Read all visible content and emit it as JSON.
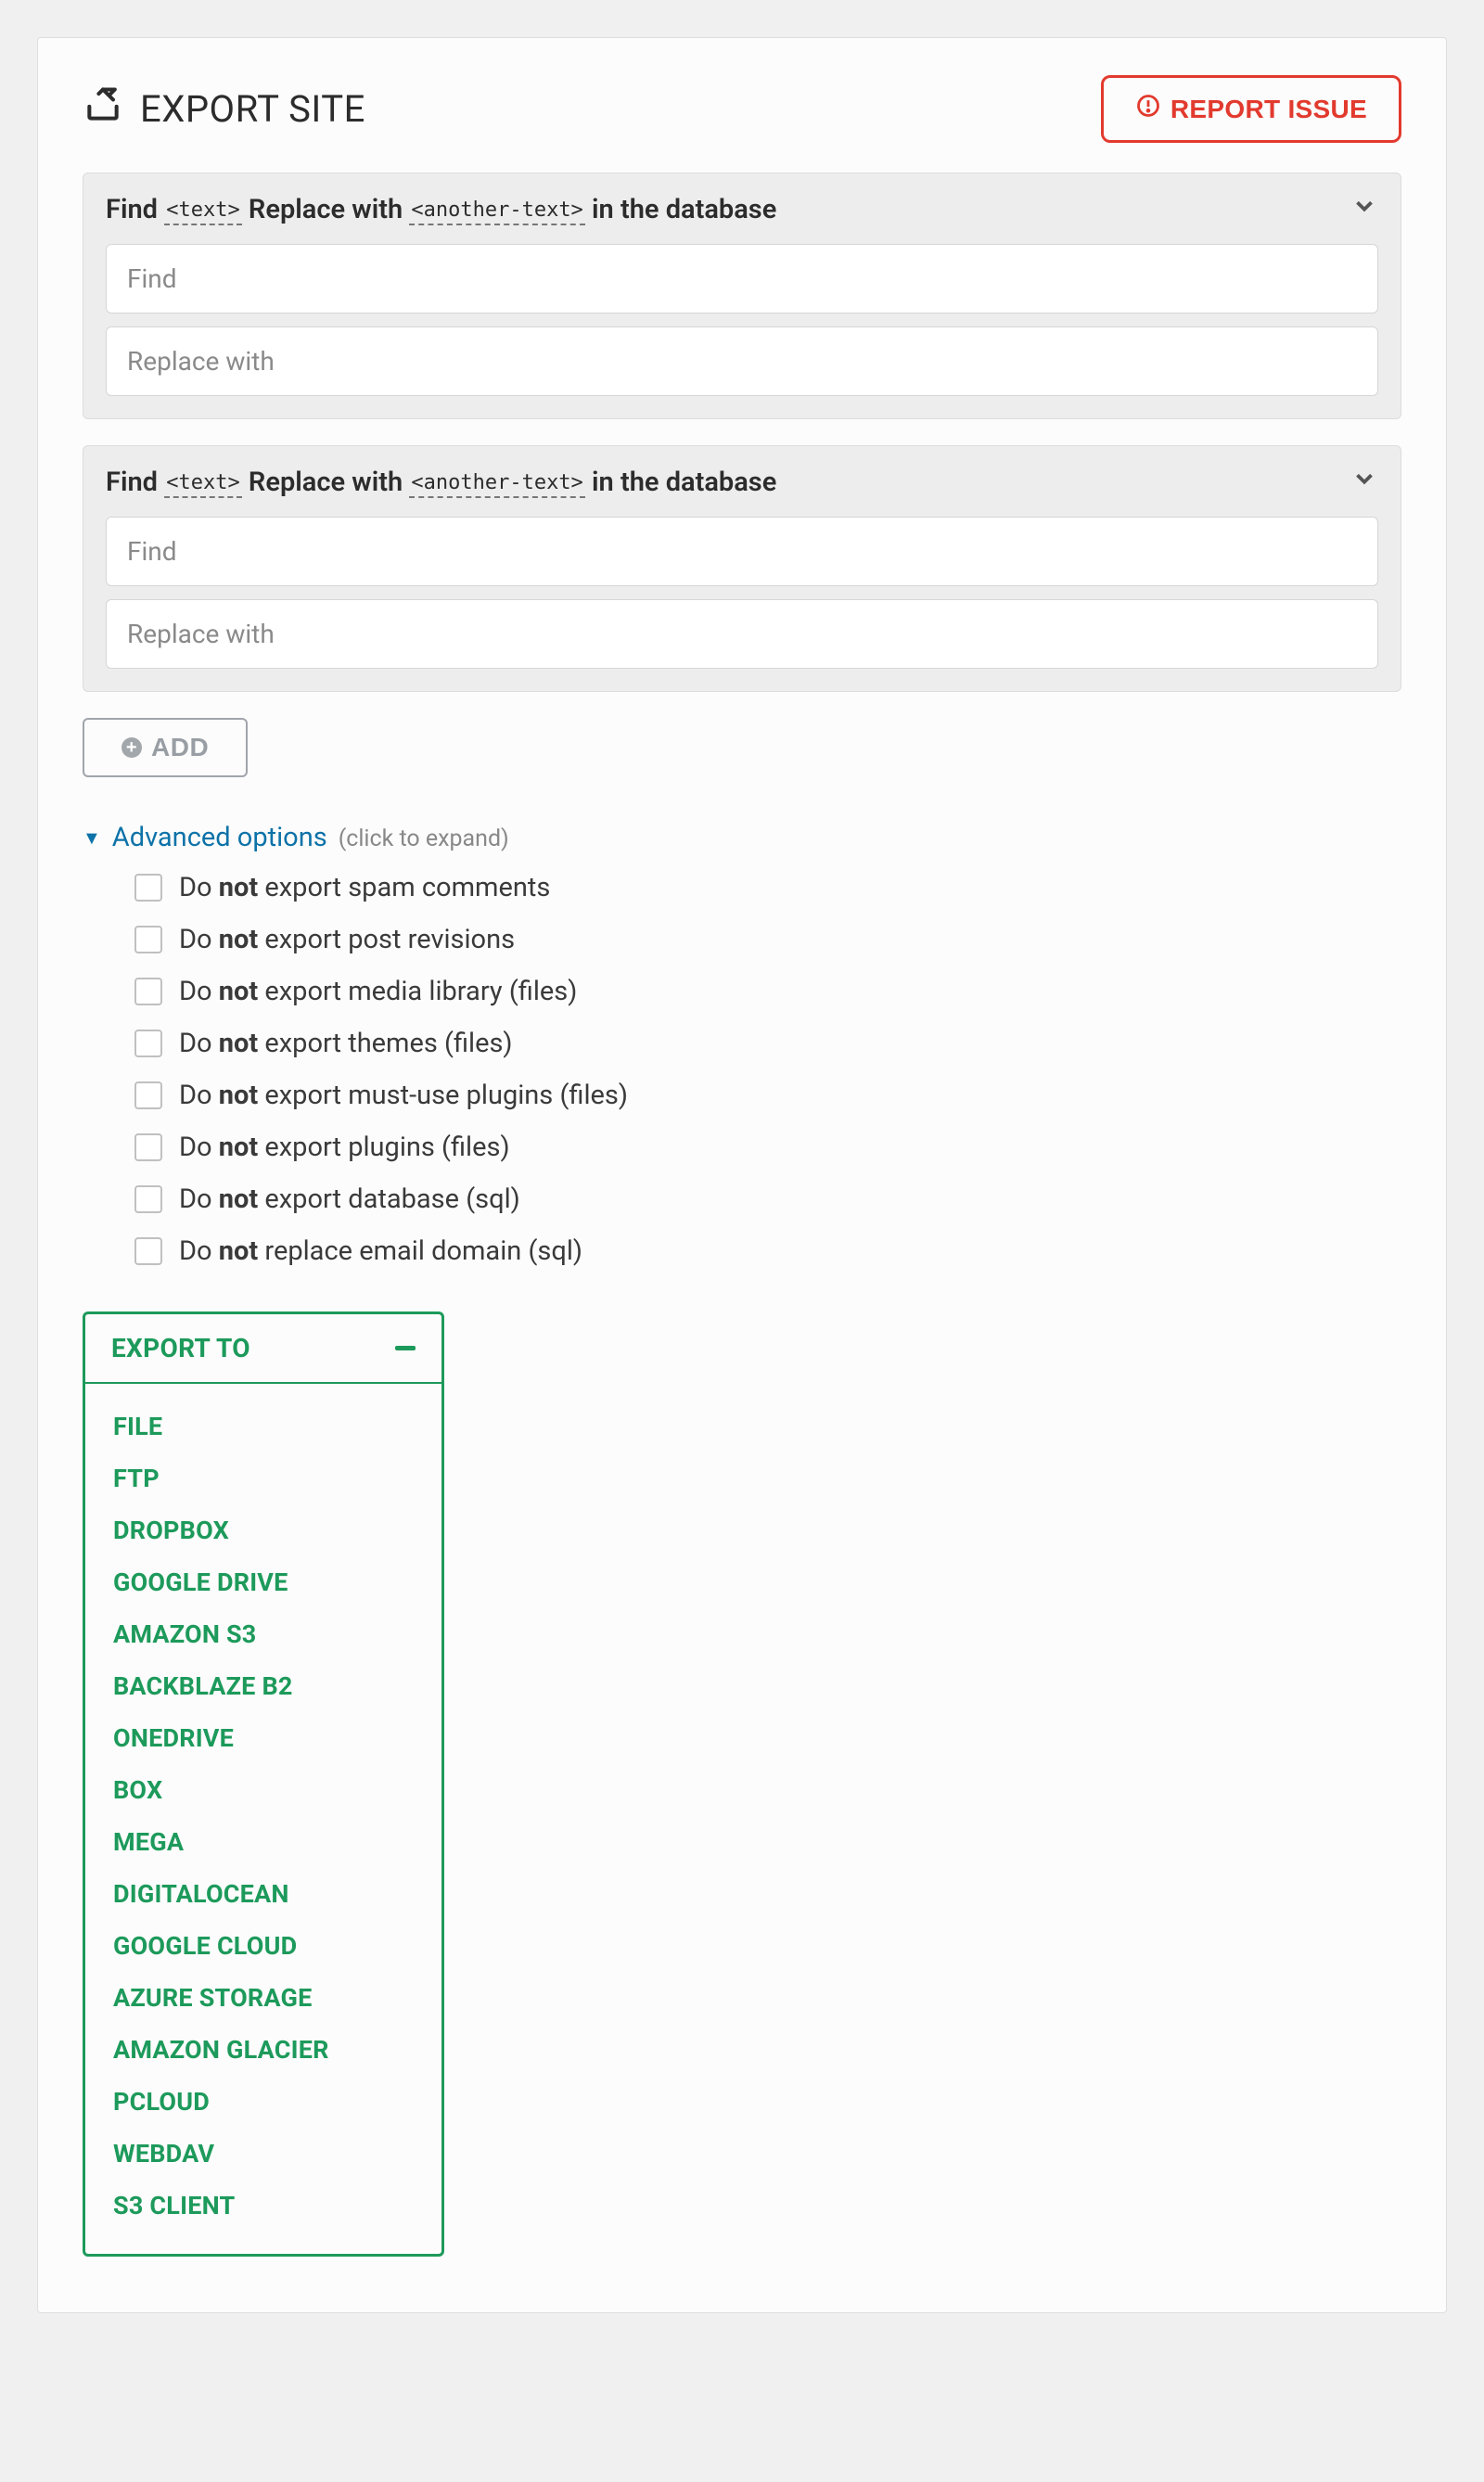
{
  "header": {
    "title": "EXPORT SITE",
    "report_label": "REPORT ISSUE"
  },
  "findreplace": {
    "prefix": "Find ",
    "token1": "<text>",
    "mid": " Replace with ",
    "token2": "<another-text>",
    "suffix": " in the database",
    "find_placeholder": "Find",
    "replace_placeholder": "Replace with"
  },
  "add_label": "ADD",
  "advanced": {
    "label": "Advanced options",
    "hint": "(click to expand)",
    "options": [
      {
        "pre": "Do ",
        "bold": "not",
        "post": " export spam comments"
      },
      {
        "pre": "Do ",
        "bold": "not",
        "post": " export post revisions"
      },
      {
        "pre": "Do ",
        "bold": "not",
        "post": " export media library (files)"
      },
      {
        "pre": "Do ",
        "bold": "not",
        "post": " export themes (files)"
      },
      {
        "pre": "Do ",
        "bold": "not",
        "post": " export must-use plugins (files)"
      },
      {
        "pre": "Do ",
        "bold": "not",
        "post": " export plugins (files)"
      },
      {
        "pre": "Do ",
        "bold": "not",
        "post": " export database (sql)"
      },
      {
        "pre": "Do ",
        "bold": "not",
        "post": " replace email domain (sql)"
      }
    ]
  },
  "export": {
    "heading": "EXPORT TO",
    "targets": [
      "FILE",
      "FTP",
      "DROPBOX",
      "GOOGLE DRIVE",
      "AMAZON S3",
      "BACKBLAZE B2",
      "ONEDRIVE",
      "BOX",
      "MEGA",
      "DIGITALOCEAN",
      "GOOGLE CLOUD",
      "AZURE STORAGE",
      "AMAZON GLACIER",
      "PCLOUD",
      "WEBDAV",
      "S3 CLIENT"
    ]
  }
}
